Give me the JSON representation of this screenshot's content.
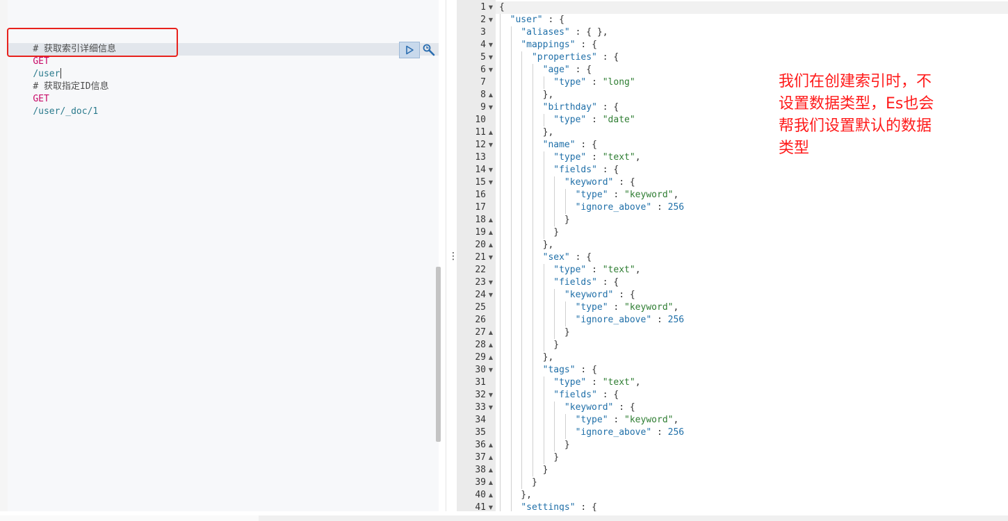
{
  "request_editor": {
    "lines": [
      {
        "kind": "comment",
        "text": "# 获取索引详细信息"
      },
      {
        "kind": "request",
        "method": "GET",
        "path": "/user"
      },
      {
        "kind": "blank",
        "text": ""
      },
      {
        "kind": "comment",
        "text": "# 获取指定ID信息"
      },
      {
        "kind": "request",
        "method": "GET",
        "path": "/user/_doc/1"
      }
    ],
    "run_icon": "play-icon",
    "wrench_icon": "wrench-icon",
    "resize_icon": "vertical-ellipsis-icon",
    "resize_glyph": "⋮"
  },
  "response_viewer": {
    "lines": [
      {
        "n": "1",
        "fold": "open",
        "code": "{"
      },
      {
        "n": "2",
        "fold": "open",
        "code": "  \"user\" : {"
      },
      {
        "n": "3",
        "fold": "",
        "code": "    \"aliases\" : { },"
      },
      {
        "n": "4",
        "fold": "open",
        "code": "    \"mappings\" : {"
      },
      {
        "n": "5",
        "fold": "open",
        "code": "      \"properties\" : {"
      },
      {
        "n": "6",
        "fold": "open",
        "code": "        \"age\" : {"
      },
      {
        "n": "7",
        "fold": "",
        "code": "          \"type\" : \"long\""
      },
      {
        "n": "8",
        "fold": "close",
        "code": "        },"
      },
      {
        "n": "9",
        "fold": "open",
        "code": "        \"birthday\" : {"
      },
      {
        "n": "10",
        "fold": "",
        "code": "          \"type\" : \"date\""
      },
      {
        "n": "11",
        "fold": "close",
        "code": "        },"
      },
      {
        "n": "12",
        "fold": "open",
        "code": "        \"name\" : {"
      },
      {
        "n": "13",
        "fold": "",
        "code": "          \"type\" : \"text\","
      },
      {
        "n": "14",
        "fold": "open",
        "code": "          \"fields\" : {"
      },
      {
        "n": "15",
        "fold": "open",
        "code": "            \"keyword\" : {"
      },
      {
        "n": "16",
        "fold": "",
        "code": "              \"type\" : \"keyword\","
      },
      {
        "n": "17",
        "fold": "",
        "code": "              \"ignore_above\" : 256"
      },
      {
        "n": "18",
        "fold": "close",
        "code": "            }"
      },
      {
        "n": "19",
        "fold": "close",
        "code": "          }"
      },
      {
        "n": "20",
        "fold": "close",
        "code": "        },"
      },
      {
        "n": "21",
        "fold": "open",
        "code": "        \"sex\" : {"
      },
      {
        "n": "22",
        "fold": "",
        "code": "          \"type\" : \"text\","
      },
      {
        "n": "23",
        "fold": "open",
        "code": "          \"fields\" : {"
      },
      {
        "n": "24",
        "fold": "open",
        "code": "            \"keyword\" : {"
      },
      {
        "n": "25",
        "fold": "",
        "code": "              \"type\" : \"keyword\","
      },
      {
        "n": "26",
        "fold": "",
        "code": "              \"ignore_above\" : 256"
      },
      {
        "n": "27",
        "fold": "close",
        "code": "            }"
      },
      {
        "n": "28",
        "fold": "close",
        "code": "          }"
      },
      {
        "n": "29",
        "fold": "close",
        "code": "        },"
      },
      {
        "n": "30",
        "fold": "open",
        "code": "        \"tags\" : {"
      },
      {
        "n": "31",
        "fold": "",
        "code": "          \"type\" : \"text\","
      },
      {
        "n": "32",
        "fold": "open",
        "code": "          \"fields\" : {"
      },
      {
        "n": "33",
        "fold": "open",
        "code": "            \"keyword\" : {"
      },
      {
        "n": "34",
        "fold": "",
        "code": "              \"type\" : \"keyword\","
      },
      {
        "n": "35",
        "fold": "",
        "code": "              \"ignore_above\" : 256"
      },
      {
        "n": "36",
        "fold": "close",
        "code": "            }"
      },
      {
        "n": "37",
        "fold": "close",
        "code": "          }"
      },
      {
        "n": "38",
        "fold": "close",
        "code": "        }"
      },
      {
        "n": "39",
        "fold": "close",
        "code": "      }"
      },
      {
        "n": "40",
        "fold": "close",
        "code": "    },"
      },
      {
        "n": "41",
        "fold": "open",
        "code": "    \"settings\" : {"
      }
    ]
  },
  "annotation": {
    "lines": [
      "我们在创建索引时，不",
      "设置数据类型，Es也会",
      "帮我们设置默认的数据",
      "类型"
    ]
  },
  "colors": {
    "highlight_box": "#e8211c",
    "annotation": "#ff1a1a",
    "method": "#c80a68",
    "key": "#1f6fa8",
    "string": "#2e7d32"
  }
}
